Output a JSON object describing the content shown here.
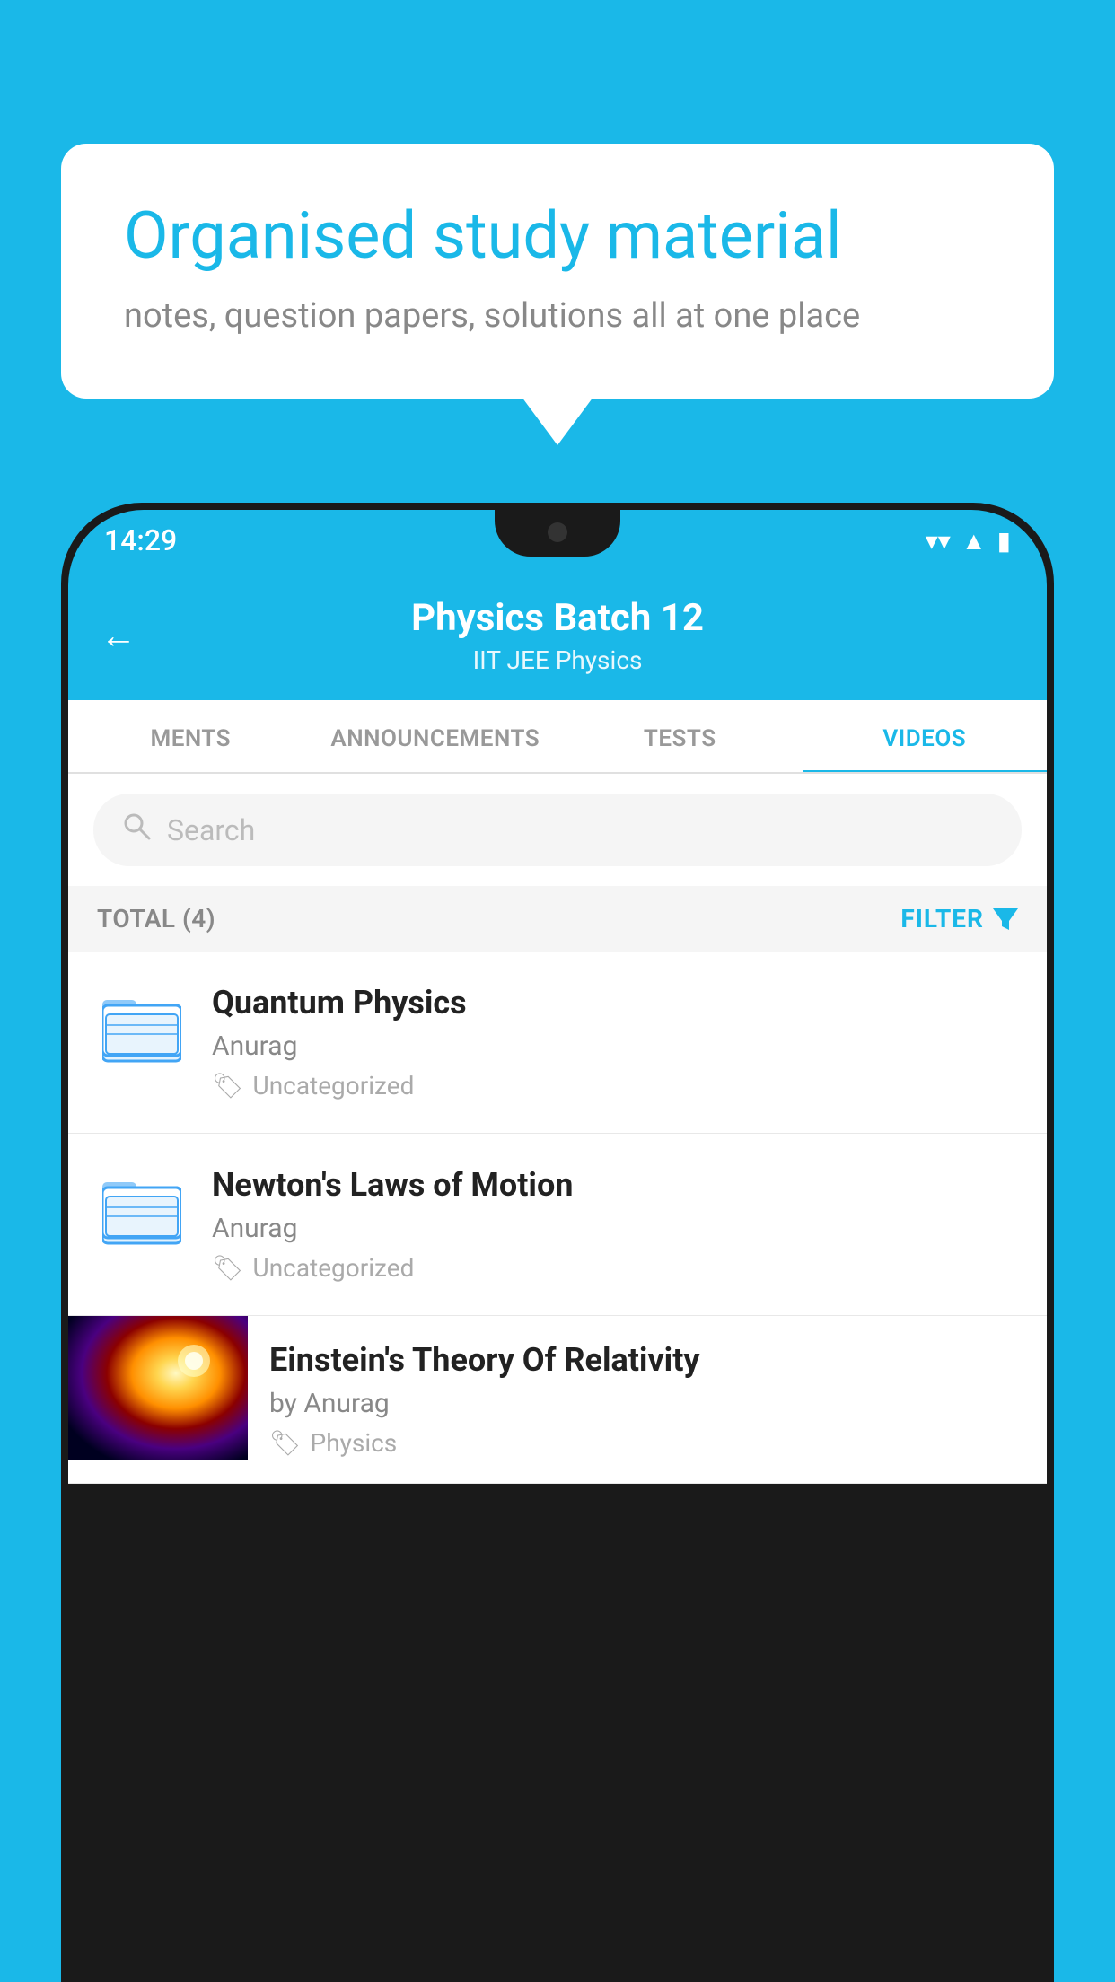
{
  "bubble": {
    "title": "Organised study material",
    "subtitle": "notes, question papers, solutions all at one place"
  },
  "statusBar": {
    "time": "14:29"
  },
  "header": {
    "title": "Physics Batch 12",
    "subtitle": "IIT JEE    Physics",
    "backLabel": "←"
  },
  "tabs": [
    {
      "label": "MENTS",
      "active": false
    },
    {
      "label": "ANNOUNCEMENTS",
      "active": false
    },
    {
      "label": "TESTS",
      "active": false
    },
    {
      "label": "VIDEOS",
      "active": true
    }
  ],
  "search": {
    "placeholder": "Search"
  },
  "filterRow": {
    "total": "TOTAL (4)",
    "filterLabel": "FILTER"
  },
  "videos": [
    {
      "title": "Quantum Physics",
      "author": "Anurag",
      "tag": "Uncategorized",
      "type": "folder"
    },
    {
      "title": "Newton's Laws of Motion",
      "author": "Anurag",
      "tag": "Uncategorized",
      "type": "folder"
    },
    {
      "title": "Einstein's Theory Of Relativity",
      "author": "by Anurag",
      "tag": "Physics",
      "type": "video"
    }
  ]
}
